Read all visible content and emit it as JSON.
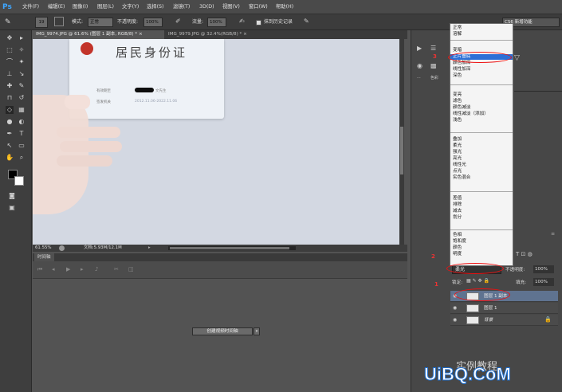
{
  "app": {
    "logo": "Ps"
  },
  "menu": [
    "文件(F)",
    "编辑(E)",
    "图像(I)",
    "图层(L)",
    "文字(Y)",
    "选择(S)",
    "滤镜(T)",
    "3D(D)",
    "视图(V)",
    "窗口(W)",
    "帮助(H)"
  ],
  "options": {
    "brush_size": "19",
    "mode_label": "模式:",
    "mode_value": "正常",
    "opacity_label": "不透明度:",
    "opacity_value": "100%",
    "flow_label": "流量:",
    "flow_value": "100%",
    "history_label": "抹到历史记录",
    "workspace": "CS6 新增功能"
  },
  "tabs": [
    {
      "label": "IMG_9974.JPG @ 61.6% (图层 1 副本, RGB/8) *",
      "close": "×"
    },
    {
      "label": "IMG_9979.JPG @ 32.4%(RGB/8) *",
      "close": "×"
    }
  ],
  "canvas": {
    "title": "居民身份证",
    "field1_label": "有效期至",
    "field1_value": "",
    "field2_label": "签发机关",
    "field2_value": "2012.11.06-2022.11.06",
    "name_suffix": "文先生"
  },
  "status": {
    "zoom": "61.55%",
    "doc": "文档:5.93M/12.1M"
  },
  "timeline": {
    "title": "时间轴",
    "create_btn": "创建视频时间轴"
  },
  "panel_left": {
    "label1": "...",
    "label2": "色彩"
  },
  "blend_menu": {
    "groups": [
      [
        "正常",
        "溶解"
      ],
      [
        "变暗",
        "正片叠底",
        "颜色加深",
        "线性加深",
        "深色"
      ],
      [
        "变亮",
        "滤色",
        "颜色减淡",
        "线性减淡（添加）",
        "浅色"
      ],
      [
        "叠加",
        "柔光",
        "强光",
        "亮光",
        "线性光",
        "点光",
        "实色混合"
      ],
      [
        "差值",
        "排除",
        "减去",
        "划分"
      ],
      [
        "色相",
        "饱和度",
        "颜色",
        "明度"
      ]
    ],
    "highlighted": "正片叠底"
  },
  "layers": {
    "blend_value": "柔光",
    "opacity_label": "不透明度:",
    "opacity_value": "100%",
    "lock_label": "锁定:",
    "fill_label": "填充:",
    "fill_value": "100%",
    "rows": [
      {
        "name": "图层 1 副本",
        "selected": true
      },
      {
        "name": "图层 1",
        "selected": false
      },
      {
        "name": "背景",
        "selected": false
      }
    ]
  },
  "annotations": {
    "n1": "1",
    "n2": "2",
    "n3": "3"
  },
  "watermark": {
    "brand": "UiBQ.CoM",
    "text": "实例教程"
  },
  "colors": {
    "accent": "#3ea6ff",
    "highlight": "#2d6fd6",
    "annotation": "#e11111"
  }
}
